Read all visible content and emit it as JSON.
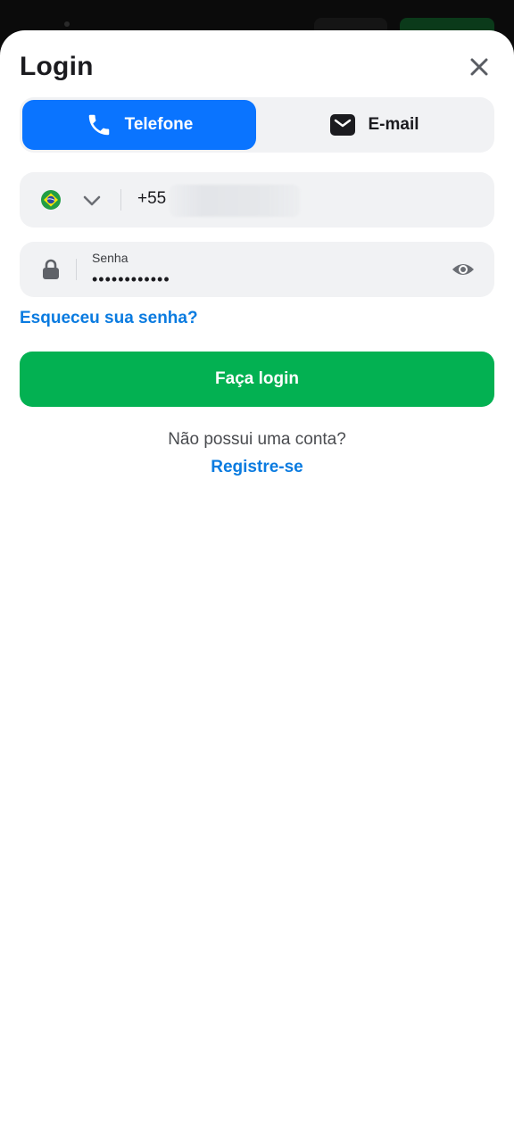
{
  "modal": {
    "title": "Login",
    "close_icon": "close-icon"
  },
  "tabs": [
    {
      "label": "Telefone",
      "icon": "phone-icon",
      "active": true
    },
    {
      "label": "E-mail",
      "icon": "mail-icon",
      "active": false
    }
  ],
  "phone": {
    "country_icon": "brazil-flag-icon",
    "dial_code": "+55",
    "value": ""
  },
  "password": {
    "label": "Senha",
    "value": "••••••••••••",
    "icon": "lock-icon",
    "toggle_icon": "eye-icon"
  },
  "links": {
    "forgot": "Esqueceu sua senha?",
    "no_account": "Não possui uma conta?",
    "register": "Registre-se"
  },
  "actions": {
    "login_label": "Faça login"
  },
  "colors": {
    "primary_blue": "#0a74ff",
    "link_blue": "#0a7be0",
    "login_green": "#03b152",
    "field_bg": "#f1f2f4"
  }
}
